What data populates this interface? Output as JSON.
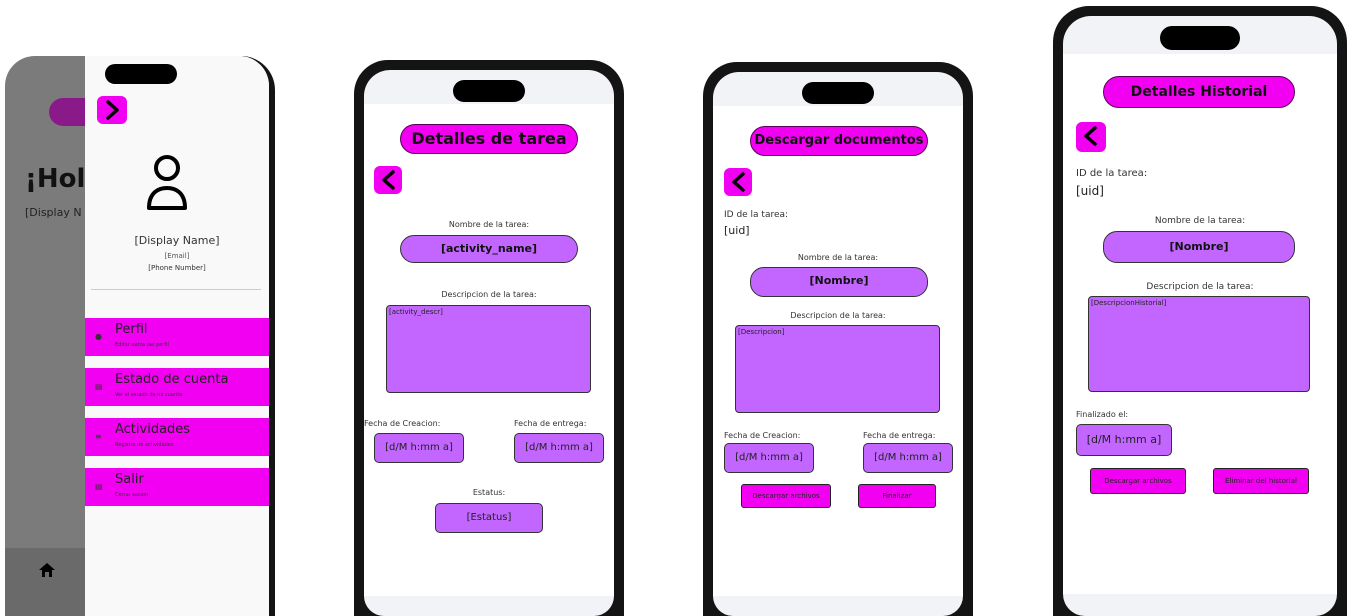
{
  "colors": {
    "accent": "#f200f2",
    "field": "#c266ff",
    "frame": "#141414"
  },
  "phone1": {
    "greeting": "¡Hol",
    "display_partial": "[Display N",
    "toggle_icon": "chevron-right-icon",
    "avatar_icon": "user-icon",
    "display_name": "[Display Name]",
    "email": "[Email]",
    "phone": "[Phone Number]",
    "menu": [
      {
        "title": "Perfil",
        "subtitle": "Editar datos del perfil",
        "icon": "person-icon"
      },
      {
        "title": "Estado de cuenta",
        "subtitle": "Ver el estado de mi cuenta",
        "icon": "account-icon"
      },
      {
        "title": "Actividades",
        "subtitle": "Registro de actividades",
        "icon": "activities-icon"
      },
      {
        "title": "Salir",
        "subtitle": "Cerrar sesion",
        "icon": "logout-icon"
      }
    ],
    "home_icon": "home-icon"
  },
  "phone2": {
    "title": "Detalles de tarea",
    "name_label": "Nombre de la tarea:",
    "name_value": "[activity_name]",
    "desc_label": "Descripcion de la tarea:",
    "desc_value": "[activity_descr]",
    "created_label": "Fecha de Creacion:",
    "created_value": "[d/M h:mm a]",
    "due_label": "Fecha de entrega:",
    "due_value": "[d/M h:mm a]",
    "status_label": "Estatus:",
    "status_value": "[Estatus]"
  },
  "phone3": {
    "title": "Descargar documentos",
    "id_label": "ID de la tarea:",
    "id_value": "[uid]",
    "name_label": "Nombre de la tarea:",
    "name_value": "[Nombre]",
    "desc_label": "Descripcion de la tarea:",
    "desc_value": "[Descripcion]",
    "created_label": "Fecha de Creacion:",
    "created_value": "[d/M h:mm a]",
    "due_label": "Fecha de entrega:",
    "due_value": "[d/M h:mm a]",
    "download_btn": "Descargar archivos",
    "finish_btn": "Finalizar"
  },
  "phone4": {
    "title": "Detalles Historial",
    "id_label": "ID de la tarea:",
    "id_value": "[uid]",
    "name_label": "Nombre de la tarea:",
    "name_value": "[Nombre]",
    "desc_label": "Descripcion de la tarea:",
    "desc_value": "[DescripcionHistorial]",
    "finished_label": "Finalizado el:",
    "finished_value": "[d/M h:mm a]",
    "download_btn": "Descargar archivos",
    "delete_btn": "Eliminar del historial"
  }
}
